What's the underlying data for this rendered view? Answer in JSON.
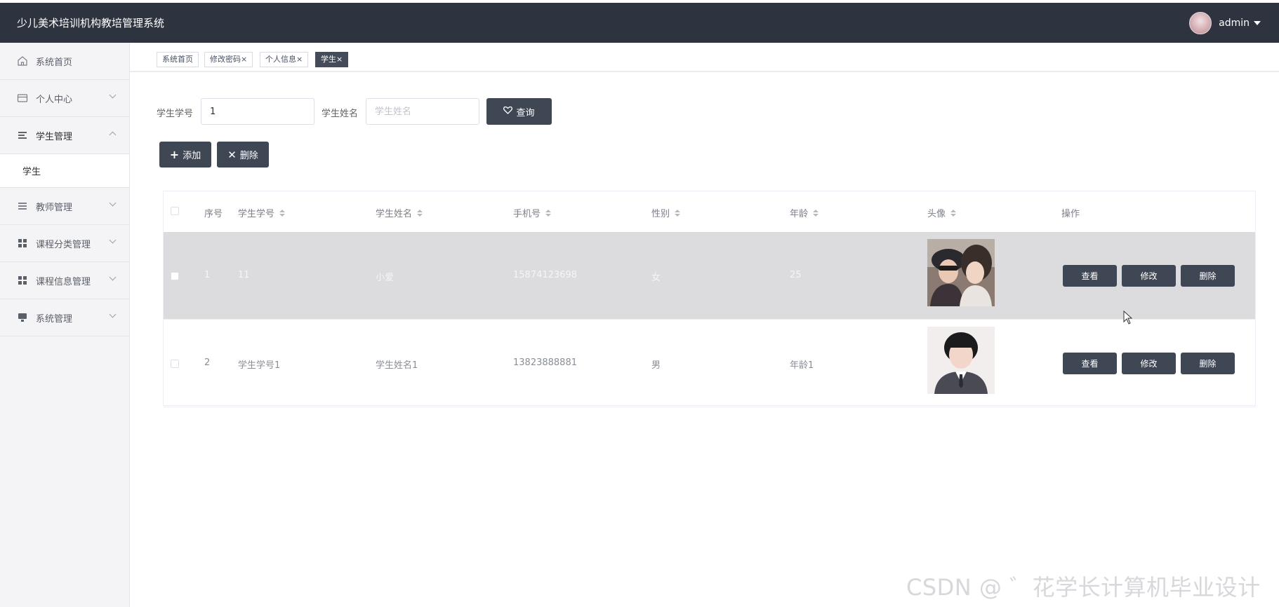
{
  "app": {
    "title": "少儿美术培训机构教培管理系统",
    "username": "admin"
  },
  "sidebar": {
    "items": [
      {
        "label": "系统首页",
        "icon": "home-icon"
      },
      {
        "label": "个人中心",
        "icon": "card-icon"
      },
      {
        "label": "学生管理",
        "icon": "list-icon"
      },
      {
        "label": "教师管理",
        "icon": "list-icon"
      },
      {
        "label": "课程分类管理",
        "icon": "grid-icon"
      },
      {
        "label": "课程信息管理",
        "icon": "grid-icon"
      },
      {
        "label": "系统管理",
        "icon": "monitor-icon"
      }
    ],
    "submenu": {
      "label": "学生"
    }
  },
  "tabs": [
    {
      "label": "系统首页"
    },
    {
      "label": "修改密码×"
    },
    {
      "label": "个人信息×"
    },
    {
      "label": "学生×"
    }
  ],
  "search": {
    "student_no_label": "学生学号",
    "student_no_value": "1",
    "student_name_label": "学生姓名",
    "student_name_placeholder": "学生姓名",
    "query_label": "查询"
  },
  "toolbar": {
    "add_label": "添加",
    "delete_label": "删除"
  },
  "table": {
    "headers": [
      "序号",
      "学生学号",
      "学生姓名",
      "手机号",
      "性别",
      "年龄",
      "头像",
      "操作"
    ],
    "rows": [
      {
        "index": "1",
        "student_no": "11",
        "name": "小爱",
        "phone": "15874123698",
        "gender": "女",
        "age": "25"
      },
      {
        "index": "2",
        "student_no": "学生学号1",
        "name": "学生姓名1",
        "phone": "13823888881",
        "gender": "男",
        "age": "年龄1"
      }
    ],
    "actions": {
      "view": "查看",
      "edit": "修改",
      "delete": "删除"
    }
  },
  "watermark": "CSDN @ ゛花学长计算机毕业设计",
  "colors": {
    "topbar": "#2d3440",
    "button": "#3f4654",
    "sidebar": "#f4f4f6",
    "row_hover": "#dcdcdf"
  }
}
